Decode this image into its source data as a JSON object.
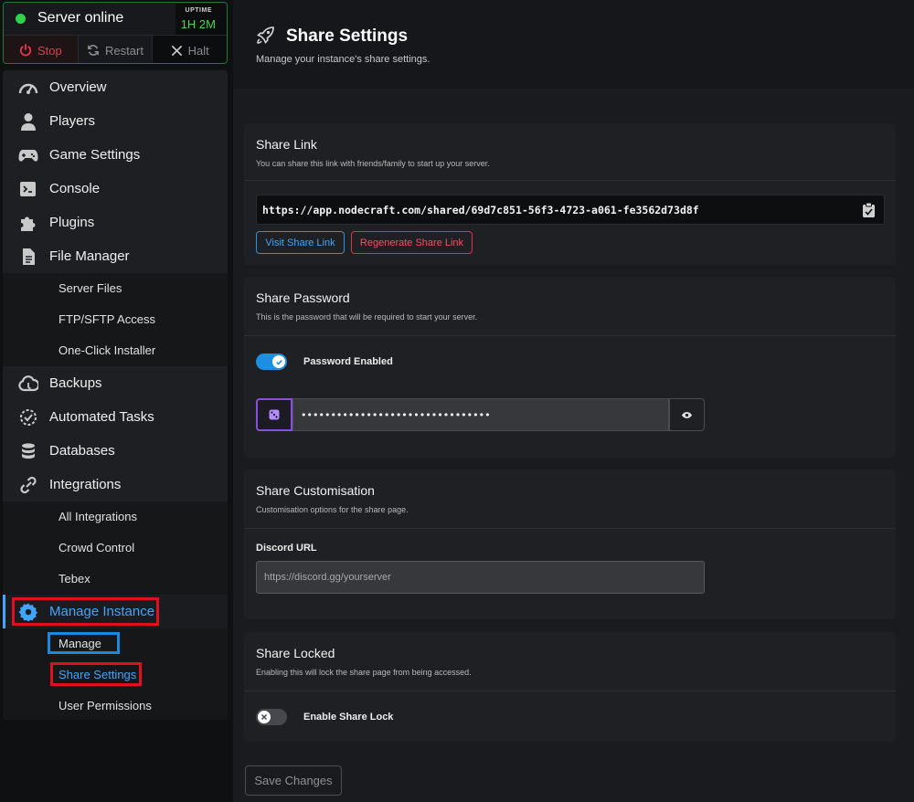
{
  "server": {
    "status_text": "Server online",
    "status_color": "#2fd34b",
    "uptime_label": "UPTIME",
    "uptime_value": "1H 2M",
    "actions": {
      "stop": "Stop",
      "restart": "Restart",
      "halt": "Halt"
    }
  },
  "sidebar": {
    "items": [
      {
        "label": "Overview",
        "icon": "speedometer-icon"
      },
      {
        "label": "Players",
        "icon": "user-icon"
      },
      {
        "label": "Game Settings",
        "icon": "gamepad-icon"
      },
      {
        "label": "Console",
        "icon": "terminal-icon"
      },
      {
        "label": "Plugins",
        "icon": "puzzle-icon"
      },
      {
        "label": "File Manager",
        "icon": "file-icon"
      },
      {
        "label": "Backups",
        "icon": "cloud-backup-icon"
      },
      {
        "label": "Automated Tasks",
        "icon": "clock-check-icon"
      },
      {
        "label": "Databases",
        "icon": "database-icon"
      },
      {
        "label": "Integrations",
        "icon": "link-icon"
      },
      {
        "label": "Manage Instance",
        "icon": "gear-icon"
      }
    ],
    "file_manager_sub": [
      "Server Files",
      "FTP/SFTP Access",
      "One-Click Installer"
    ],
    "integrations_sub": [
      "All Integrations",
      "Crowd Control",
      "Tebex"
    ],
    "manage_sub": [
      "Manage",
      "Share Settings",
      "User Permissions"
    ],
    "active_color": "#3ea6ff"
  },
  "page": {
    "title": "Share Settings",
    "subtitle": "Manage your instance's share settings.",
    "icon": "rocket-icon"
  },
  "share_link": {
    "title": "Share Link",
    "description": "You can share this link with friends/family to start up your server.",
    "url": "https://app.nodecraft.com/shared/69d7c851-56f3-4723-a061-fe3562d73d8f",
    "visit_label": "Visit Share Link",
    "regenerate_label": "Regenerate Share Link"
  },
  "share_password": {
    "title": "Share Password",
    "description": "This is the password that will be required to start your server.",
    "toggle_label": "Password Enabled",
    "toggle_on": true,
    "password_value": "••••••••••••••••••••••••••••••••"
  },
  "share_customisation": {
    "title": "Share Customisation",
    "description": "Customisation options for the share page.",
    "discord_label": "Discord URL",
    "discord_placeholder": "https://discord.gg/yourserver"
  },
  "share_locked": {
    "title": "Share Locked",
    "description": "Enabling this will lock the share page from being accessed.",
    "toggle_label": "Enable Share Lock",
    "toggle_on": false
  },
  "footer": {
    "save_label": "Save Changes"
  }
}
